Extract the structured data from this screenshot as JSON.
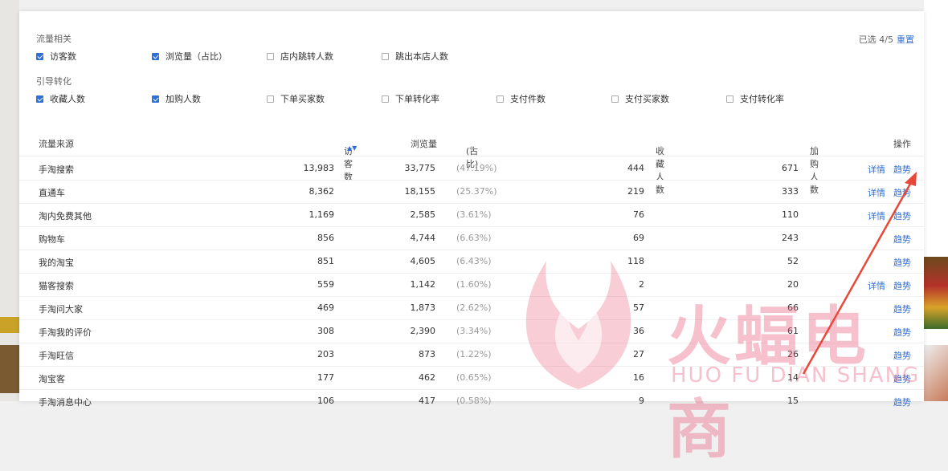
{
  "filters": {
    "traffic_group_title": "流量相关",
    "traffic_options": [
      {
        "label": "访客数",
        "checked": true
      },
      {
        "label": "浏览量（占比）",
        "checked": true
      },
      {
        "label": "店内跳转人数",
        "checked": false
      },
      {
        "label": "跳出本店人数",
        "checked": false
      }
    ],
    "conversion_group_title": "引导转化",
    "conversion_options": [
      {
        "label": "收藏人数",
        "checked": true
      },
      {
        "label": "加购人数",
        "checked": true
      },
      {
        "label": "下单买家数",
        "checked": false
      },
      {
        "label": "下单转化率",
        "checked": false
      },
      {
        "label": "支付件数",
        "checked": false
      },
      {
        "label": "支付买家数",
        "checked": false
      },
      {
        "label": "支付转化率",
        "checked": false
      }
    ],
    "selected_text": "已选 4/5",
    "reset_label": "重置"
  },
  "table": {
    "headers": {
      "source": "流量来源",
      "visitors": "访客数",
      "pageviews": "浏览量",
      "share": "(占比)",
      "favorites": "收藏人数",
      "cart": "加购人数",
      "ops": "操作"
    },
    "rows": [
      {
        "source": "手淘搜索",
        "visitors": "13,983",
        "pv": "33,775",
        "pct": "(47.19%)",
        "fav": "444",
        "cart": "671",
        "detail": "详情",
        "trend": "趋势"
      },
      {
        "source": "直通车",
        "visitors": "8,362",
        "pv": "18,155",
        "pct": "(25.37%)",
        "fav": "219",
        "cart": "333",
        "detail": "详情",
        "trend": "趋势"
      },
      {
        "source": "淘内免费其他",
        "visitors": "1,169",
        "pv": "2,585",
        "pct": "(3.61%)",
        "fav": "76",
        "cart": "110",
        "detail": "详情",
        "trend": "趋势"
      },
      {
        "source": "购物车",
        "visitors": "856",
        "pv": "4,744",
        "pct": "(6.63%)",
        "fav": "69",
        "cart": "243",
        "detail": "",
        "trend": "趋势"
      },
      {
        "source": "我的淘宝",
        "visitors": "851",
        "pv": "4,605",
        "pct": "(6.43%)",
        "fav": "118",
        "cart": "52",
        "detail": "",
        "trend": "趋势"
      },
      {
        "source": "猫客搜索",
        "visitors": "559",
        "pv": "1,142",
        "pct": "(1.60%)",
        "fav": "2",
        "cart": "20",
        "detail": "详情",
        "trend": "趋势"
      },
      {
        "source": "手淘问大家",
        "visitors": "469",
        "pv": "1,873",
        "pct": "(2.62%)",
        "fav": "57",
        "cart": "66",
        "detail": "",
        "trend": "趋势"
      },
      {
        "source": "手淘我的评价",
        "visitors": "308",
        "pv": "2,390",
        "pct": "(3.34%)",
        "fav": "36",
        "cart": "61",
        "detail": "",
        "trend": "趋势"
      },
      {
        "source": "手淘旺信",
        "visitors": "203",
        "pv": "873",
        "pct": "(1.22%)",
        "fav": "27",
        "cart": "26",
        "detail": "",
        "trend": "趋势"
      },
      {
        "source": "淘宝客",
        "visitors": "177",
        "pv": "462",
        "pct": "(0.65%)",
        "fav": "16",
        "cart": "14",
        "detail": "",
        "trend": "趋势"
      },
      {
        "source": "手淘消息中心",
        "visitors": "106",
        "pv": "417",
        "pct": "(0.58%)",
        "fav": "9",
        "cart": "15",
        "detail": "",
        "trend": "趋势"
      }
    ]
  },
  "watermark": {
    "main": "火蝠电商",
    "sub": "HUO FU DIAN SHANG"
  },
  "colors": {
    "accent": "#2f6fd8",
    "watermark": "#e85a78",
    "annotation_arrow": "#e8483a"
  }
}
